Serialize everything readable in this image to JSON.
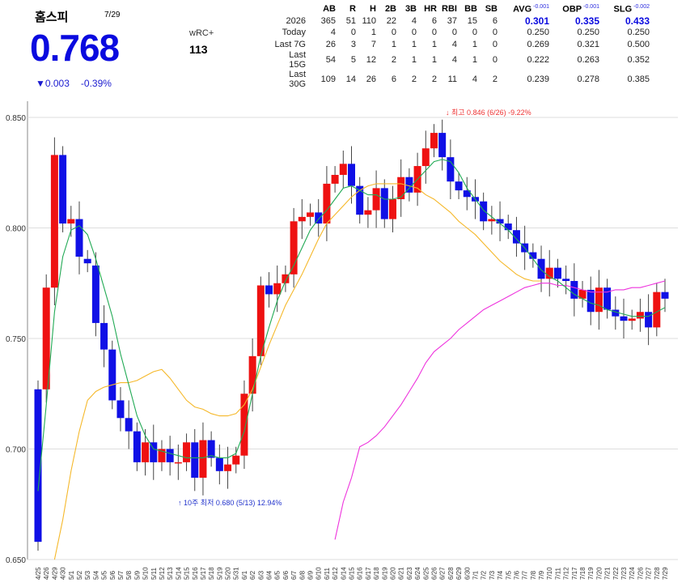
{
  "header": {
    "name": "홈스피",
    "date": "7/29",
    "value": "0.768",
    "change": "▼0.003",
    "change_pct": "-0.39%",
    "wrc_label": "wRC+",
    "wrc_value": "113"
  },
  "stats": {
    "columns": [
      "AB",
      "R",
      "H",
      "2B",
      "3B",
      "HR",
      "RBI",
      "BB",
      "SB"
    ],
    "rate_columns": [
      {
        "label": "AVG",
        "delta": "-0.001"
      },
      {
        "label": "OBP",
        "delta": "-0.001"
      },
      {
        "label": "SLG",
        "delta": "-0.002"
      }
    ],
    "season": {
      "label": "2026",
      "values": [
        "365",
        "51",
        "110",
        "22",
        "4",
        "6",
        "37",
        "15",
        "6"
      ],
      "rates": [
        "0.301",
        "0.335",
        "0.433"
      ]
    },
    "rows": [
      {
        "label": "Today",
        "values": [
          "4",
          "0",
          "1",
          "0",
          "0",
          "0",
          "0",
          "0",
          "0"
        ],
        "rates": [
          "0.250",
          "0.250",
          "0.250"
        ]
      },
      {
        "label": "Last 7G",
        "values": [
          "26",
          "3",
          "7",
          "1",
          "1",
          "1",
          "4",
          "1",
          "0"
        ],
        "rates": [
          "0.269",
          "0.321",
          "0.500"
        ]
      },
      {
        "label": "Last 15G",
        "values": [
          "54",
          "5",
          "12",
          "2",
          "1",
          "1",
          "4",
          "1",
          "0"
        ],
        "rates": [
          "0.222",
          "0.263",
          "0.352"
        ]
      },
      {
        "label": "Last 30G",
        "values": [
          "109",
          "14",
          "26",
          "6",
          "2",
          "2",
          "11",
          "4",
          "2"
        ],
        "rates": [
          "0.239",
          "0.278",
          "0.385"
        ]
      }
    ]
  },
  "colors": {
    "up": "#ee1111",
    "down": "#1010e6",
    "ma5": "#22aa55",
    "ma20": "#f5b82a",
    "ma60": "#ee33dd",
    "accent": "#0a0adf"
  },
  "annotations": {
    "high": "↓ 최고 0.846 (6/26) -9.22%",
    "low": "↑ 10주 최저 0.680 (5/13) 12.94%"
  },
  "chart_data": {
    "type": "candlestick",
    "ylim": [
      0.65,
      0.85
    ],
    "yticks": [
      "0.650",
      "0.700",
      "0.750",
      "0.800",
      "0.850"
    ],
    "categories": [
      "4/25",
      "4/26",
      "4/28",
      "4/29",
      "4/30",
      "5/1",
      "5/2",
      "5/3",
      "5/4",
      "5/5",
      "5/6",
      "5/7",
      "5/8",
      "5/9",
      "5/10",
      "5/11",
      "5/12",
      "5/13",
      "5/14",
      "5/15",
      "5/16",
      "5/17",
      "5/18",
      "5/19",
      "5/20",
      "5/21",
      "5/31",
      "6/1",
      "6/2",
      "6/3",
      "6/4",
      "6/5",
      "6/6",
      "6/7",
      "6/8",
      "6/9",
      "6/10",
      "6/11",
      "6/12",
      "6/14",
      "6/15",
      "6/16",
      "6/17",
      "6/18",
      "6/19",
      "6/20",
      "6/21",
      "6/23",
      "6/24",
      "6/25",
      "6/26",
      "6/27",
      "6/28",
      "6/29",
      "6/30",
      "7/1",
      "7/2",
      "7/3",
      "7/4",
      "7/5",
      "7/6",
      "7/7",
      "7/8",
      "7/9",
      "7/10",
      "7/11",
      "7/12",
      "7/17",
      "7/18",
      "7/19",
      "7/20",
      "7/21",
      "7/22",
      "7/23",
      "7/24",
      "7/26",
      "7/27",
      "7/28",
      "7/29"
    ],
    "x_tick_labels": [
      "4/25",
      "4/26",
      "4/29",
      "4/30",
      "5/1",
      "5/2",
      "5/3",
      "5/4",
      "5/5",
      "5/6",
      "5/7",
      "5/8",
      "5/9",
      "5/10",
      "5/11",
      "5/12",
      "5/13",
      "5/14",
      "5/15",
      "5/16",
      "5/17",
      "5/18",
      "5/19",
      "5/20",
      "5/31",
      "6/1",
      "6/2",
      "6/3",
      "6/4",
      "6/5",
      "6/6",
      "6/7",
      "6/8",
      "6/9",
      "6/10",
      "6/11",
      "6/12",
      "6/14",
      "6/15",
      "6/16",
      "6/17",
      "6/18",
      "6/19",
      "6/20",
      "6/21",
      "6/23",
      "6/24",
      "6/25",
      "6/26",
      "6/27",
      "6/28",
      "6/29",
      "6/30",
      "7/1",
      "7/2",
      "7/3",
      "7/4",
      "7/5",
      "7/6",
      "7/7",
      "7/8",
      "7/9",
      "7/10",
      "7/11",
      "7/12",
      "7/17",
      "7/18",
      "7/19",
      "7/20",
      "7/21",
      "7/22",
      "7/23",
      "7/24",
      "7/26",
      "7/27",
      "7/28",
      "7/29"
    ],
    "candles": [
      [
        0.727,
        0.658
      ],
      [
        0.727,
        0.773
      ],
      [
        0.773,
        0.833
      ],
      [
        0.833,
        0.802
      ],
      [
        0.802,
        0.804
      ],
      [
        0.804,
        0.787
      ],
      [
        0.786,
        0.784
      ],
      [
        0.783,
        0.757
      ],
      [
        0.757,
        0.745
      ],
      [
        0.745,
        0.722
      ],
      [
        0.722,
        0.714
      ],
      [
        0.714,
        0.708
      ],
      [
        0.708,
        0.694
      ],
      [
        0.694,
        0.703
      ],
      [
        0.703,
        0.694
      ],
      [
        0.694,
        0.7
      ],
      [
        0.7,
        0.694
      ],
      [
        0.694,
        0.694
      ],
      [
        0.694,
        0.703
      ],
      [
        0.703,
        0.687
      ],
      [
        0.687,
        0.704
      ],
      [
        0.704,
        0.696
      ],
      [
        0.696,
        0.69
      ],
      [
        0.69,
        0.693
      ],
      [
        0.693,
        0.697
      ],
      [
        0.697,
        0.725
      ],
      [
        0.725,
        0.742
      ],
      [
        0.742,
        0.774
      ],
      [
        0.774,
        0.77
      ],
      [
        0.77,
        0.775
      ],
      [
        0.775,
        0.779
      ],
      [
        0.779,
        0.803
      ],
      [
        0.803,
        0.805
      ],
      [
        0.805,
        0.807
      ],
      [
        0.807,
        0.802
      ],
      [
        0.802,
        0.82
      ],
      [
        0.82,
        0.824
      ],
      [
        0.824,
        0.829
      ],
      [
        0.829,
        0.819
      ],
      [
        0.819,
        0.806
      ],
      [
        0.806,
        0.808
      ],
      [
        0.808,
        0.818
      ],
      [
        0.818,
        0.804
      ],
      [
        0.804,
        0.813
      ],
      [
        0.813,
        0.823
      ],
      [
        0.823,
        0.816
      ],
      [
        0.816,
        0.828
      ],
      [
        0.828,
        0.836
      ],
      [
        0.836,
        0.843
      ],
      [
        0.843,
        0.832
      ],
      [
        0.832,
        0.821
      ],
      [
        0.821,
        0.817
      ],
      [
        0.817,
        0.814
      ],
      [
        0.814,
        0.812
      ],
      [
        0.812,
        0.803
      ],
      [
        0.803,
        0.804
      ],
      [
        0.804,
        0.802
      ],
      [
        0.802,
        0.799
      ],
      [
        0.799,
        0.793
      ],
      [
        0.793,
        0.789
      ],
      [
        0.789,
        0.786
      ],
      [
        0.786,
        0.777
      ],
      [
        0.777,
        0.782
      ],
      [
        0.782,
        0.777
      ],
      [
        0.777,
        0.776
      ],
      [
        0.776,
        0.768
      ],
      [
        0.768,
        0.772
      ],
      [
        0.772,
        0.762
      ],
      [
        0.762,
        0.773
      ],
      [
        0.773,
        0.763
      ],
      [
        0.763,
        0.76
      ],
      [
        0.76,
        0.758
      ],
      [
        0.758,
        0.759
      ],
      [
        0.759,
        0.762
      ],
      [
        0.762,
        0.755
      ],
      [
        0.755,
        0.771
      ],
      [
        0.771,
        0.768
      ]
    ],
    "ma5": [
      0.681,
      0.72,
      0.762,
      0.787,
      0.799,
      0.801,
      0.797,
      0.786,
      0.773,
      0.76,
      0.743,
      0.729,
      0.715,
      0.706,
      0.7,
      0.699,
      0.698,
      0.697,
      0.696,
      0.696,
      0.696,
      0.697,
      0.696,
      0.696,
      0.698,
      0.708,
      0.725,
      0.742,
      0.755,
      0.767,
      0.776,
      0.783,
      0.791,
      0.799,
      0.804,
      0.808,
      0.813,
      0.818,
      0.819,
      0.817,
      0.815,
      0.815,
      0.813,
      0.813,
      0.814,
      0.818,
      0.822,
      0.826,
      0.83,
      0.831,
      0.83,
      0.825,
      0.818,
      0.813,
      0.808,
      0.805,
      0.802,
      0.799,
      0.795,
      0.791,
      0.786,
      0.781,
      0.778,
      0.776,
      0.773,
      0.77,
      0.768,
      0.766,
      0.765,
      0.763,
      0.762,
      0.761,
      0.76,
      0.76,
      0.76,
      0.762,
      0.764
    ],
    "ma20": [
      null,
      null,
      0.65,
      0.668,
      0.69,
      0.708,
      0.722,
      0.726,
      0.728,
      0.729,
      0.73,
      0.73,
      0.731,
      0.733,
      0.735,
      0.736,
      0.732,
      0.727,
      0.722,
      0.719,
      0.718,
      0.716,
      0.715,
      0.715,
      0.716,
      0.72,
      0.727,
      0.737,
      0.747,
      0.756,
      0.765,
      0.772,
      0.779,
      0.787,
      0.795,
      0.802,
      0.806,
      0.81,
      0.814,
      0.817,
      0.819,
      0.82,
      0.82,
      0.82,
      0.82,
      0.819,
      0.818,
      0.815,
      0.813,
      0.81,
      0.807,
      0.803,
      0.8,
      0.797,
      0.793,
      0.789,
      0.785,
      0.782,
      0.779,
      0.777,
      0.776,
      0.776
    ],
    "ma60": [
      null,
      null,
      null,
      null,
      null,
      null,
      null,
      null,
      null,
      null,
      null,
      null,
      null,
      null,
      null,
      null,
      null,
      null,
      null,
      null,
      null,
      null,
      null,
      null,
      null,
      null,
      null,
      null,
      null,
      null,
      null,
      null,
      null,
      null,
      null,
      null,
      0.659,
      0.676,
      0.687,
      0.701,
      0.703,
      0.706,
      0.71,
      0.715,
      0.72,
      0.726,
      0.732,
      0.739,
      0.744,
      0.747,
      0.75,
      0.754,
      0.757,
      0.76,
      0.763,
      0.765,
      0.767,
      0.769,
      0.771,
      0.773,
      0.774,
      0.775,
      0.775,
      0.774,
      0.774,
      0.773,
      0.772,
      0.771,
      0.771,
      0.771,
      0.772,
      0.772,
      0.773,
      0.773,
      0.774,
      0.775,
      0.776
    ]
  }
}
